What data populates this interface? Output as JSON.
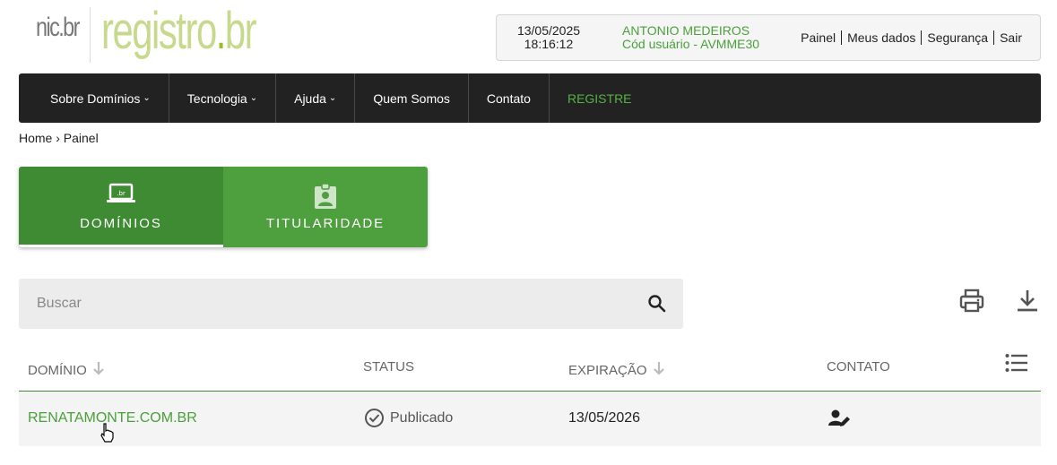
{
  "logo": {
    "nic": "nic.br",
    "registro_main": "registro",
    "registro_dot": ".",
    "registro_tld": "br"
  },
  "userbox": {
    "date": "13/05/2025",
    "time": "18:16:12",
    "user_name": "ANTONIO MEDEIROS",
    "user_code": "Cód usuário - AVMME30",
    "links": [
      "Painel",
      "Meus dados",
      "Segurança",
      "Sair"
    ]
  },
  "nav": {
    "items": [
      {
        "label": "Sobre Domínios",
        "chevron": "⌄"
      },
      {
        "label": "Tecnologia",
        "chevron": "⌄"
      },
      {
        "label": "Ajuda",
        "chevron": "⌄"
      },
      {
        "label": "Quem Somos",
        "chevron": ""
      },
      {
        "label": "Contato",
        "chevron": ""
      },
      {
        "label": "REGISTRE",
        "chevron": ""
      }
    ]
  },
  "breadcrumb": "Home › Painel",
  "tabs": [
    {
      "label": "DOMÍNIOS",
      "icon": "laptop-icon",
      "active": true
    },
    {
      "label": "TITULARIDADE",
      "icon": "id-badge-icon",
      "active": false
    }
  ],
  "search": {
    "placeholder": "Buscar",
    "value": ""
  },
  "table": {
    "headers": {
      "domain": "DOMÍNIO",
      "status": "STATUS",
      "expiration": "EXPIRAÇÃO",
      "contact": "CONTATO"
    },
    "rows": [
      {
        "domain": "RENATAMONTE.COM.BR",
        "status": "Publicado",
        "expiration": "13/05/2026"
      }
    ]
  },
  "colors": {
    "accent_green": "#4aa03a",
    "tab_active": "#3e8b33",
    "tab_inactive": "#4e9f3d",
    "nav_bg": "#222222",
    "logo_green": "#c7d98c"
  }
}
